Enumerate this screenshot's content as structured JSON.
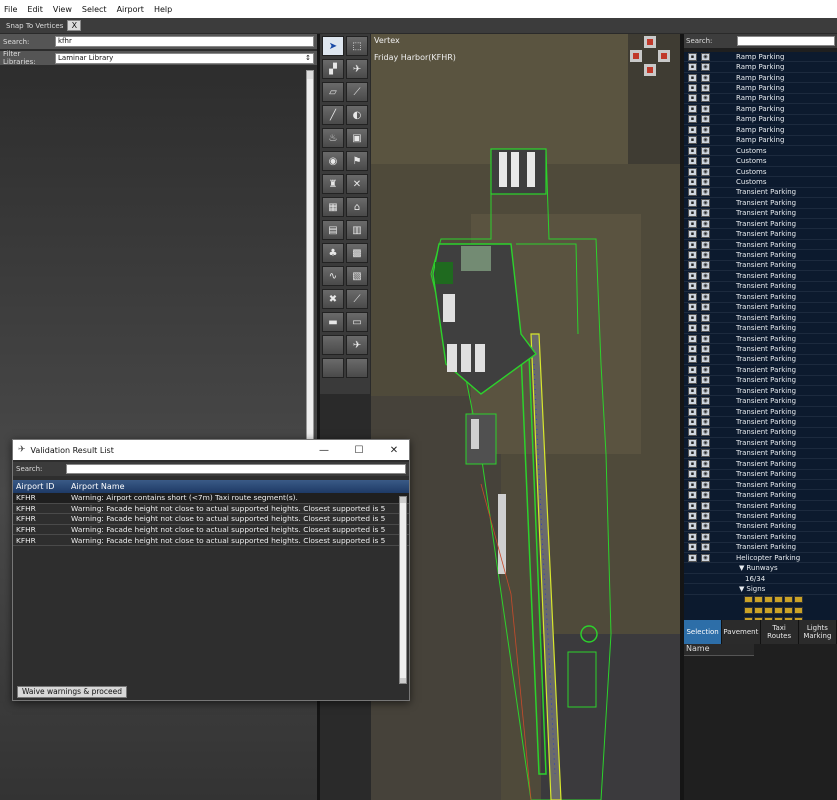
{
  "menu": [
    "File",
    "Edit",
    "View",
    "Select",
    "Airport",
    "Help"
  ],
  "toolbar": {
    "snap_label": "Snap To Vertices",
    "snap_toggle": "X"
  },
  "library": {
    "search_label": "Search:",
    "search_value": "kfhr",
    "filter_label": "Filter Libraries:",
    "filter_value": "Laminar Library"
  },
  "map": {
    "tool_label": "Vertex",
    "airport_label": "Friday Harbor(KFHR)"
  },
  "hierarchy": {
    "search_label": "Search:",
    "rows": [
      {
        "text": "Ramp Parking",
        "kind": "item"
      },
      {
        "text": "Ramp Parking",
        "kind": "item"
      },
      {
        "text": "Ramp Parking",
        "kind": "item"
      },
      {
        "text": "Ramp Parking",
        "kind": "item"
      },
      {
        "text": "Ramp Parking",
        "kind": "item"
      },
      {
        "text": "Ramp Parking",
        "kind": "item"
      },
      {
        "text": "Ramp Parking",
        "kind": "item"
      },
      {
        "text": "Ramp Parking",
        "kind": "item"
      },
      {
        "text": "Ramp Parking",
        "kind": "item"
      },
      {
        "text": "Customs",
        "kind": "item"
      },
      {
        "text": "Customs",
        "kind": "item"
      },
      {
        "text": "Customs",
        "kind": "item"
      },
      {
        "text": "Customs",
        "kind": "item"
      },
      {
        "text": "Transient Parking",
        "kind": "item"
      },
      {
        "text": "Transient Parking",
        "kind": "item"
      },
      {
        "text": "Transient Parking",
        "kind": "item"
      },
      {
        "text": "Transient Parking",
        "kind": "item"
      },
      {
        "text": "Transient Parking",
        "kind": "item"
      },
      {
        "text": "Transient Parking",
        "kind": "item"
      },
      {
        "text": "Transient Parking",
        "kind": "item"
      },
      {
        "text": "Transient Parking",
        "kind": "item"
      },
      {
        "text": "Transient Parking",
        "kind": "item"
      },
      {
        "text": "Transient Parking",
        "kind": "item"
      },
      {
        "text": "Transient Parking",
        "kind": "item"
      },
      {
        "text": "Transient Parking",
        "kind": "item"
      },
      {
        "text": "Transient Parking",
        "kind": "item"
      },
      {
        "text": "Transient Parking",
        "kind": "item"
      },
      {
        "text": "Transient Parking",
        "kind": "item"
      },
      {
        "text": "Transient Parking",
        "kind": "item"
      },
      {
        "text": "Transient Parking",
        "kind": "item"
      },
      {
        "text": "Transient Parking",
        "kind": "item"
      },
      {
        "text": "Transient Parking",
        "kind": "item"
      },
      {
        "text": "Transient Parking",
        "kind": "item"
      },
      {
        "text": "Transient Parking",
        "kind": "item"
      },
      {
        "text": "Transient Parking",
        "kind": "item"
      },
      {
        "text": "Transient Parking",
        "kind": "item"
      },
      {
        "text": "Transient Parking",
        "kind": "item"
      },
      {
        "text": "Transient Parking",
        "kind": "item"
      },
      {
        "text": "Transient Parking",
        "kind": "item"
      },
      {
        "text": "Transient Parking",
        "kind": "item"
      },
      {
        "text": "Transient Parking",
        "kind": "item"
      },
      {
        "text": "Transient Parking",
        "kind": "item"
      },
      {
        "text": "Transient Parking",
        "kind": "item"
      },
      {
        "text": "Transient Parking",
        "kind": "item"
      },
      {
        "text": "Transient Parking",
        "kind": "item"
      },
      {
        "text": "Transient Parking",
        "kind": "item"
      },
      {
        "text": "Transient Parking",
        "kind": "item"
      },
      {
        "text": "Transient Parking",
        "kind": "item"
      },
      {
        "text": "Helicopter Parking",
        "kind": "item"
      },
      {
        "text": "Runways",
        "kind": "group"
      },
      {
        "text": "16/34",
        "kind": "sub"
      },
      {
        "text": "Signs",
        "kind": "group"
      }
    ],
    "tabs": [
      "Selection",
      "Pavement",
      "Taxi Routes",
      "Lights Marking"
    ],
    "name_header": "Name"
  },
  "dialog": {
    "title": "Validation Result List",
    "search_label": "Search:",
    "col_id": "Airport ID",
    "col_name": "Airport Name",
    "rows": [
      {
        "id": "KFHR",
        "msg": "Warning: Airport contains short (<7m) Taxi route segment(s)."
      },
      {
        "id": "KFHR",
        "msg": "Warning: Facade height not close to actual supported heights. Closest supported is 5"
      },
      {
        "id": "KFHR",
        "msg": "Warning: Facade height not close to actual supported heights. Closest supported is 5"
      },
      {
        "id": "KFHR",
        "msg": "Warning: Facade height not close to actual supported heights. Closest supported is 5"
      },
      {
        "id": "KFHR",
        "msg": "Warning: Facade height not close to actual supported heights. Closest supported is 5"
      }
    ],
    "waive_label": "Waive warnings & proceed"
  }
}
